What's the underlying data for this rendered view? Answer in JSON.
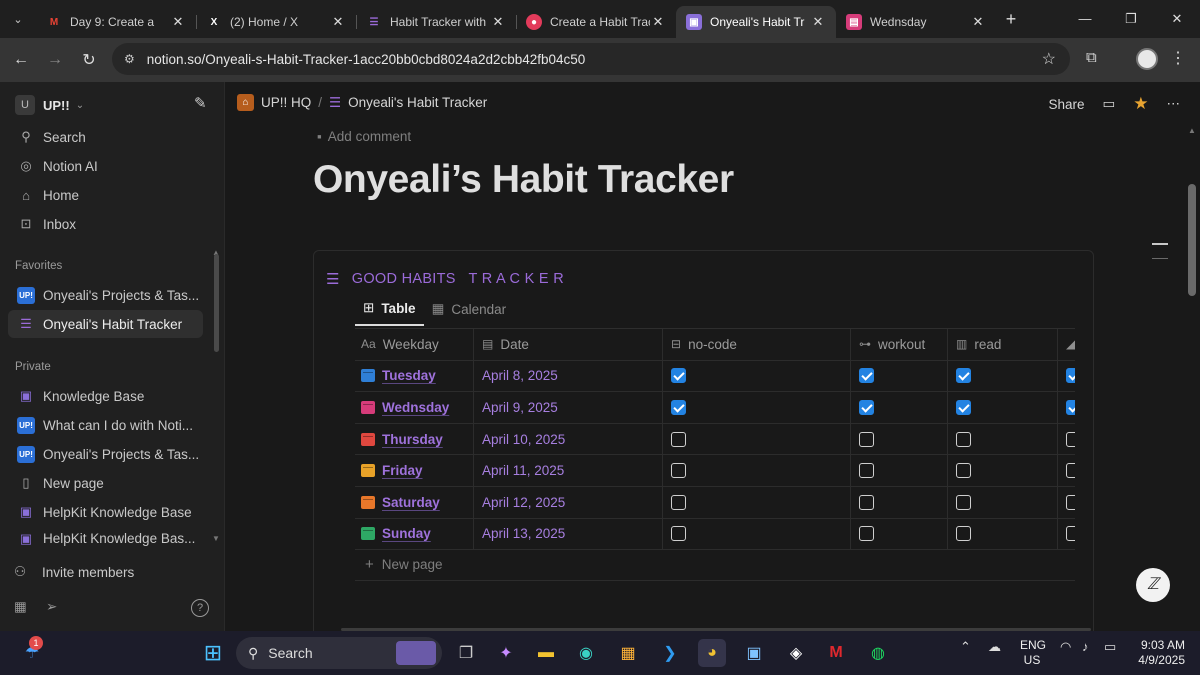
{
  "browser": {
    "tabs": [
      {
        "title": "Day 9: Create a",
        "icon": "gmail-icon",
        "color": "#ea4335"
      },
      {
        "title": "(2) Home / X",
        "icon": "x-icon",
        "color": "#ffffff"
      },
      {
        "title": "Habit Tracker with",
        "icon": "checklist-icon",
        "color": "#9b6bd9"
      },
      {
        "title": "Create a Habit Trac",
        "icon": "record-icon",
        "color": "#e23b5b"
      },
      {
        "title": "Onyeali's Habit Tr",
        "icon": "cube-icon",
        "color": "#8a6fd9"
      },
      {
        "title": "Wednsday",
        "icon": "calendar-icon",
        "color": "#d63c7a"
      }
    ],
    "active_tab": 4,
    "url": "notion.so/Onyeali-s-Habit-Tracker-1acc20bb0cbd8024a2d2cbb42fb04c50"
  },
  "sidebar": {
    "workspace": "UP!!",
    "workspace_initial": "U",
    "nav": [
      {
        "label": "Search",
        "icon": "search-icon"
      },
      {
        "label": "Notion AI",
        "icon": "notion-ai-icon"
      },
      {
        "label": "Home",
        "icon": "home-icon"
      },
      {
        "label": "Inbox",
        "icon": "inbox-icon"
      }
    ],
    "favorites_heading": "Favorites",
    "favorites": [
      {
        "label": "Onyeali's Projects & Tas...",
        "icon": "up-icon"
      },
      {
        "label": "Onyeali's Habit Tracker",
        "icon": "checklist-icon",
        "selected": true
      }
    ],
    "private_heading": "Private",
    "private": [
      {
        "label": "Knowledge Base",
        "icon": "cube-icon"
      },
      {
        "label": "What can I do with Noti...",
        "icon": "up-icon"
      },
      {
        "label": "Onyeali's Projects & Tas...",
        "icon": "up-icon"
      },
      {
        "label": "New page",
        "icon": "page-icon"
      },
      {
        "label": "HelpKit Knowledge Base",
        "icon": "cube-icon"
      },
      {
        "label": "HelpKit Knowledge Bas...",
        "icon": "cube-icon"
      }
    ],
    "invite": "Invite members",
    "up_badge": "UP!"
  },
  "page": {
    "breadcrumb": [
      "UP!! HQ",
      "Onyeali's Habit Tracker"
    ],
    "share": "Share",
    "add_comment": "Add comment",
    "title": "Onyeali’s Habit Tracker"
  },
  "database": {
    "title": "GOOD HABITS   T R A C K E R",
    "views": [
      "Table",
      "Calendar"
    ],
    "columns": [
      "Weekday",
      "Date",
      "no-code",
      "workout",
      "read"
    ],
    "column_type_label": "Aa",
    "rows": [
      {
        "day": "Tuesday",
        "date": "April 8, 2025",
        "color": "#2f7fd6",
        "checks": [
          true,
          true,
          true,
          true
        ]
      },
      {
        "day": "Wednsday",
        "date": "April 9, 2025",
        "color": "#d63c7a",
        "checks": [
          true,
          true,
          true,
          true
        ]
      },
      {
        "day": "Thursday",
        "date": "April 10, 2025",
        "color": "#e0483f",
        "checks": [
          false,
          false,
          false,
          false
        ]
      },
      {
        "day": "Friday",
        "date": "April 11, 2025",
        "color": "#e8a228",
        "checks": [
          false,
          false,
          false,
          false
        ]
      },
      {
        "day": "Saturday",
        "date": "April 12, 2025",
        "color": "#e8772a",
        "checks": [
          false,
          false,
          false,
          false
        ]
      },
      {
        "day": "Sunday",
        "date": "April 13, 2025",
        "color": "#2ea865",
        "checks": [
          false,
          false,
          false,
          false
        ]
      }
    ],
    "new_page": "New page"
  },
  "taskbar": {
    "search": "Search",
    "lang": [
      "ENG",
      "US"
    ],
    "time": "9:03 AM",
    "date": "4/9/2025",
    "notification_count": "1"
  }
}
